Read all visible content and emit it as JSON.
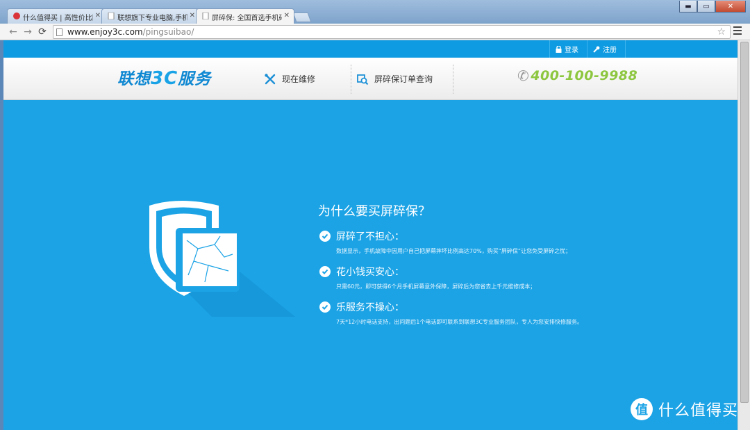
{
  "browser": {
    "tabs": [
      {
        "title": "什么值得买 | 高性价比网购",
        "active": false
      },
      {
        "title": "联想旗下专业电脑,手机,平板",
        "active": false
      },
      {
        "title": "屏碎保: 全国首选手机碎屏险",
        "active": true
      }
    ],
    "url_host": "www.enjoy3c.com",
    "url_path": "/pingsuibao/",
    "window_buttons": {
      "minimize": "▬",
      "maximize": "▭",
      "close": "✕"
    }
  },
  "topbar": {
    "login_label": "登录",
    "register_label": "注册",
    "login_icon": "lock-icon",
    "register_icon": "wrench-icon"
  },
  "header": {
    "logo_text_a": "联想",
    "logo_text_b": "3C",
    "logo_text_c": "服务",
    "nav": [
      {
        "label": "现在维修",
        "icon": "repair-tools-icon"
      },
      {
        "label": "屏碎保订单查询",
        "icon": "order-search-icon"
      }
    ],
    "hotline": "400-100-9988",
    "hotline_icon": "phone-icon"
  },
  "promo": {
    "title": "为什么要买屏碎保？",
    "features": [
      {
        "title": "屏碎了不担心：",
        "desc": "数据显示，手机故障中因用户自己把屏幕摔坏比例高达70%，购买“屏碎保”让您免受屏碎之忧；"
      },
      {
        "title": "花小钱买安心：",
        "desc": "只需60元，即可获得6个月手机屏幕意外保障，屏碎后为您省去上千元维修成本；"
      },
      {
        "title": "乐服务不操心：",
        "desc": "7天*12小时电话支持，出问题后1个电话即可联系到联想3C专业服务团队，专人为您安排快修服务。"
      }
    ]
  },
  "watermark": {
    "logo_char": "值",
    "text": "什么值得买"
  },
  "colors": {
    "page_bg": "#1ba3e6",
    "topbar_bg": "#0e9be2",
    "hotline": "#8dc63f",
    "logo": "#0f88d2"
  }
}
